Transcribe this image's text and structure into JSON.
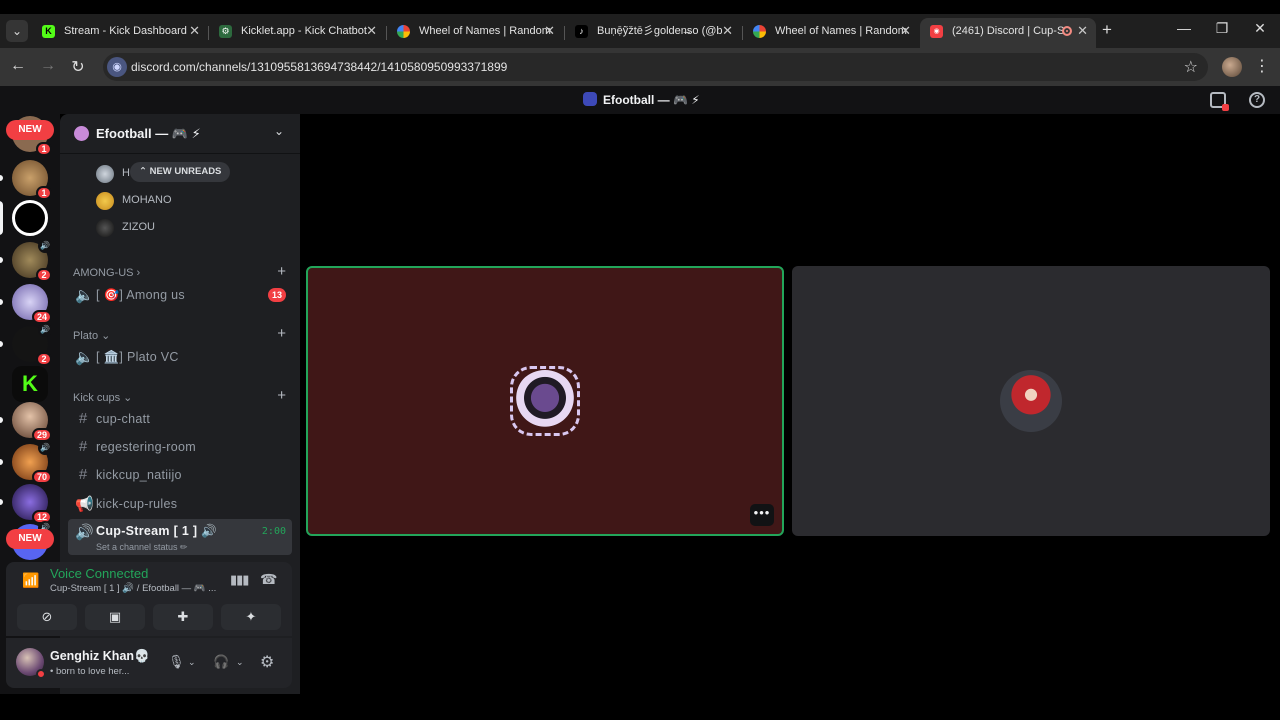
{
  "browser": {
    "tabs": [
      {
        "title": "Stream - Kick Dashboard",
        "favicon": "kick-icon",
        "active": false
      },
      {
        "title": "Kicklet.app - Kick Chatbot",
        "favicon": "kicklet-icon",
        "active": false
      },
      {
        "title": "Wheel of Names | Random",
        "favicon": "wheel-icon",
        "active": false
      },
      {
        "title": "Buṇẹ̄ỹžtē彡golden̶so (@b",
        "favicon": "tiktok-icon",
        "active": false
      },
      {
        "title": "Wheel of Names | Random",
        "favicon": "wheel-icon",
        "active": false
      },
      {
        "title": "(2461) Discord | Cup-S",
        "favicon": "discord-icon",
        "active": true
      }
    ],
    "url": "discord.com/channels/1310955813694738442/1410580950993371899"
  },
  "discord": {
    "window_title": "Efootball — 🎮 ⚡",
    "guild_name": "Efootball — 🎮 ⚡",
    "servers": [
      {
        "name": "server-1",
        "badge": "1",
        "color": "#8a6a50",
        "new": true
      },
      {
        "name": "server-2",
        "badge": "1",
        "color": "#a07c4e"
      },
      {
        "name": "efootball-server",
        "badge": "",
        "color": "#ffffff"
      },
      {
        "name": "server-4",
        "badge": "2",
        "color": "#6b5a3a",
        "voice": true
      },
      {
        "name": "server-5",
        "badge": "24",
        "color": "#8d84b8"
      },
      {
        "name": "server-6",
        "badge": "2",
        "color": "#1a1a1a",
        "voice": true
      },
      {
        "name": "kick-server",
        "badge": "",
        "color": "#53fc18"
      },
      {
        "name": "server-8",
        "badge": "29",
        "color": "#b89a86"
      },
      {
        "name": "server-9",
        "badge": "70",
        "color": "#c0702e",
        "voice": true
      },
      {
        "name": "server-10",
        "badge": "12",
        "color": "#3d2b7a"
      },
      {
        "name": "server-11",
        "badge": "",
        "color": "#5865f2",
        "new": true,
        "voice": true
      }
    ],
    "new_label": "NEW",
    "new_unreads_label": "NEW UNREADS",
    "voice_users": [
      "H",
      "MOHANO",
      "ZIZOU"
    ],
    "categories": [
      {
        "label": "AMONG-US ›"
      },
      {
        "label": "Plato ⌄"
      },
      {
        "label": "Kick cups ⌄"
      }
    ],
    "channels": {
      "among_us": {
        "name": "[ 🎯] Among us",
        "badge": "13"
      },
      "plato": {
        "name": "[ 🏛️] Plato VC"
      },
      "cup_chatt": {
        "name": "cup-chatt"
      },
      "registering": {
        "name": "regestering-room"
      },
      "natiijo": {
        "name": "kickcup_natiijo"
      },
      "rules": {
        "name": "kick-cup-rules"
      },
      "cup_stream": {
        "name": "Cup-Stream [ 1 ] 🔊",
        "time": "2:00",
        "status": "Set a channel status ✏"
      }
    },
    "voice_panel": {
      "status": "Voice Connected",
      "channel": "Cup-Stream [ 1 ] 🔊 / Efootball — 🎮 ..."
    },
    "user": {
      "name": "Genghiz Khan💀",
      "subtext": "• born to love her..."
    },
    "tiles": [
      {
        "user": "speaking-user",
        "speaking": true
      },
      {
        "user": "second-user",
        "speaking": false
      }
    ]
  },
  "colors": {
    "speaking_border": "#23a55a",
    "mention_red": "#f23f43",
    "tile_1_bg": "#401717",
    "tile_2_bg": "#2b2b2f"
  }
}
